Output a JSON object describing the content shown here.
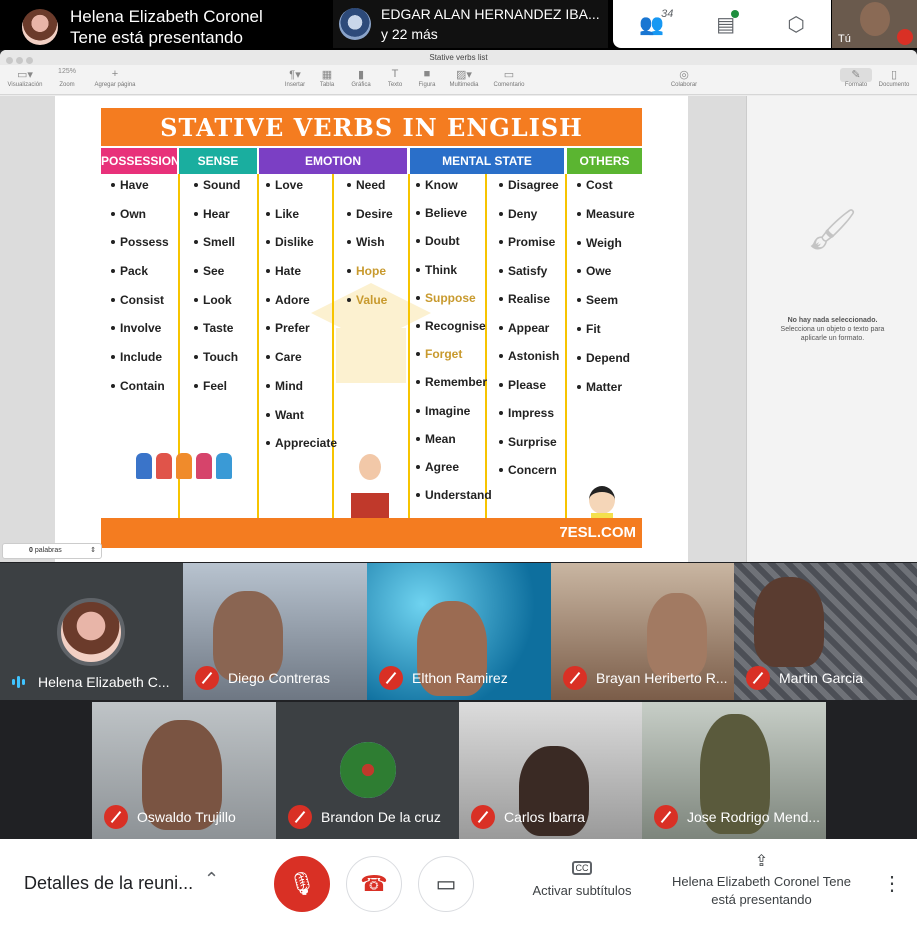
{
  "topbar": {
    "presenter_line1": "Helena Elizabeth Coronel",
    "presenter_line2": "Tene está presentando",
    "others_line1": "EDGAR ALAN HERNANDEZ IBA...",
    "others_line2": "y 22 más",
    "participants_count": "34",
    "self_label": "Tú"
  },
  "app": {
    "window_title": "Stative verbs list",
    "toolbar_left": [
      {
        "icon": "view-icon",
        "label": "Visualización"
      },
      {
        "icon": "zoom-icon",
        "label": "Zoom",
        "value": "125%"
      },
      {
        "icon": "add-page-icon",
        "label": "Agregar página"
      }
    ],
    "toolbar_mid": [
      {
        "icon": "paragraph-icon",
        "label": "Insertar"
      },
      {
        "icon": "table-icon",
        "label": "Tabla"
      },
      {
        "icon": "chart-icon",
        "label": "Gráfica"
      },
      {
        "icon": "text-icon",
        "label": "Texto"
      },
      {
        "icon": "shape-icon",
        "label": "Figura"
      },
      {
        "icon": "media-icon",
        "label": "Multimedia"
      },
      {
        "icon": "comment-icon",
        "label": "Comentario"
      }
    ],
    "toolbar_right": [
      {
        "icon": "collaborate-icon",
        "label": "Colaborar"
      },
      {
        "icon": "format-icon",
        "label": "Formato"
      },
      {
        "icon": "document-icon",
        "label": "Documento"
      }
    ],
    "inspector_title": "No hay nada seleccionado.",
    "inspector_text": "Selecciona un objeto o texto para aplicarle un formato.",
    "word_count_value": "0",
    "word_count_label": "palabras"
  },
  "poster": {
    "title": "STATIVE VERBS IN ENGLISH",
    "headers": [
      {
        "label": "POSSESSION",
        "color": "#e8317a"
      },
      {
        "label": "SENSE",
        "color": "#1aae9f"
      },
      {
        "label": "EMOTION",
        "color": "#7b3fc4"
      },
      {
        "label": "MENTAL STATE",
        "color": "#2a6fc9"
      },
      {
        "label": "OTHERS",
        "color": "#5bb531"
      }
    ],
    "columns": {
      "possession": [
        "Have",
        "Own",
        "Possess",
        "Pack",
        "Consist",
        "Involve",
        "Include",
        "Contain"
      ],
      "sense": [
        "Sound",
        "Hear",
        "Smell",
        "See",
        "Look",
        "Taste",
        "Touch",
        "Feel"
      ],
      "emotion_a": [
        "Love",
        "Like",
        "Dislike",
        "Hate",
        "Adore",
        "Prefer",
        "Care",
        "Mind",
        "Want",
        "Appreciate"
      ],
      "emotion_b": [
        "Need",
        "Desire",
        "Wish",
        "Hope",
        "Value"
      ],
      "mental_a": [
        "Know",
        "Believe",
        "Doubt",
        "Think",
        "Suppose",
        "Recognise",
        "Forget",
        "Remember",
        "Imagine",
        "Mean",
        "Agree",
        "Understand"
      ],
      "mental_b": [
        "Disagree",
        "Deny",
        "Promise",
        "Satisfy",
        "Realise",
        "Appear",
        "Astonish",
        "Please",
        "Impress",
        "Surprise",
        "Concern"
      ],
      "others": [
        "Cost",
        "Measure",
        "Weigh",
        "Owe",
        "Seem",
        "Fit",
        "Depend",
        "Matter"
      ]
    },
    "footer_logo": "7ESL.COM"
  },
  "participants": [
    {
      "name": "Helena Elizabeth C...",
      "speaking": true
    },
    {
      "name": "Diego Contreras"
    },
    {
      "name": "Elthon Ramirez"
    },
    {
      "name": "Brayan Heriberto R..."
    },
    {
      "name": "Martin Garcia"
    },
    {
      "name": "Oswaldo Trujillo"
    },
    {
      "name": "Brandon De la cruz"
    },
    {
      "name": "Carlos Ibarra"
    },
    {
      "name": "Jose Rodrigo Mend..."
    }
  ],
  "bottombar": {
    "details": "Detalles de la reuni...",
    "captions": "Activar subtítulos",
    "captions_icon": "CC",
    "presenting": "Helena Elizabeth Coronel Tene está presentando"
  }
}
